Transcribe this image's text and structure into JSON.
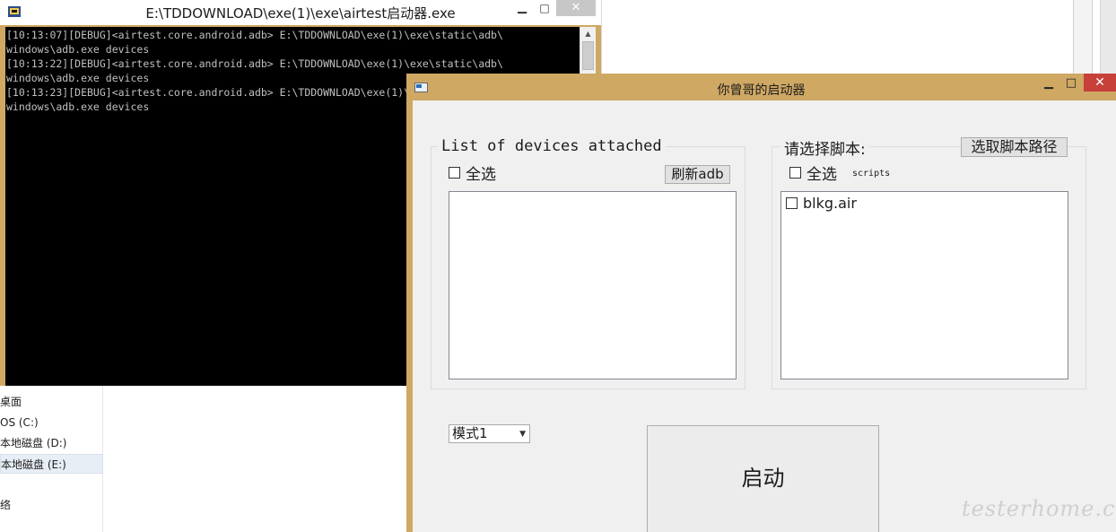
{
  "console": {
    "title": "E:\\TDDOWNLOAD\\exe(1)\\exe\\airtest启动器.exe",
    "minimize": "▁",
    "maximize": "□",
    "close": "✕",
    "lines": [
      "[10:13:07][DEBUG]<airtest.core.android.adb> E:\\TDDOWNLOAD\\exe(1)\\exe\\static\\adb\\",
      "windows\\adb.exe devices",
      "[10:13:22][DEBUG]<airtest.core.android.adb> E:\\TDDOWNLOAD\\exe(1)\\exe\\static\\adb\\",
      "windows\\adb.exe devices",
      "[10:13:23][DEBUG]<airtest.core.android.adb> E:\\TDDOWNLOAD\\exe(1)\\exe\\static\\adb\\",
      "windows\\adb.exe devices"
    ]
  },
  "explorer": {
    "nav_items": [
      "桌面",
      "OS (C:)",
      "本地磁盘 (D:)",
      "本地磁盘 (E:)",
      "络"
    ]
  },
  "launcher": {
    "title": "你曾哥的启动器",
    "minimize": "▁",
    "maximize": "□",
    "close": "✕",
    "devices_group": {
      "title": "List of devices attached",
      "select_all_label": "全选",
      "refresh_button": "刷新adb"
    },
    "scripts_group": {
      "title": "请选择脚本:",
      "choose_path_button": "选取脚本路径",
      "select_all_label": "全选",
      "scripts_caption": "scripts",
      "items": [
        "blkg.air"
      ]
    },
    "mode_select": {
      "value": "模式1"
    },
    "launch_button": "启动"
  },
  "watermark": "testerhome.com",
  "colors": {
    "window_frame": "#cfa864",
    "close_button": "#c7403a",
    "console_bg": "#000000",
    "console_text": "#c0c0c0"
  }
}
